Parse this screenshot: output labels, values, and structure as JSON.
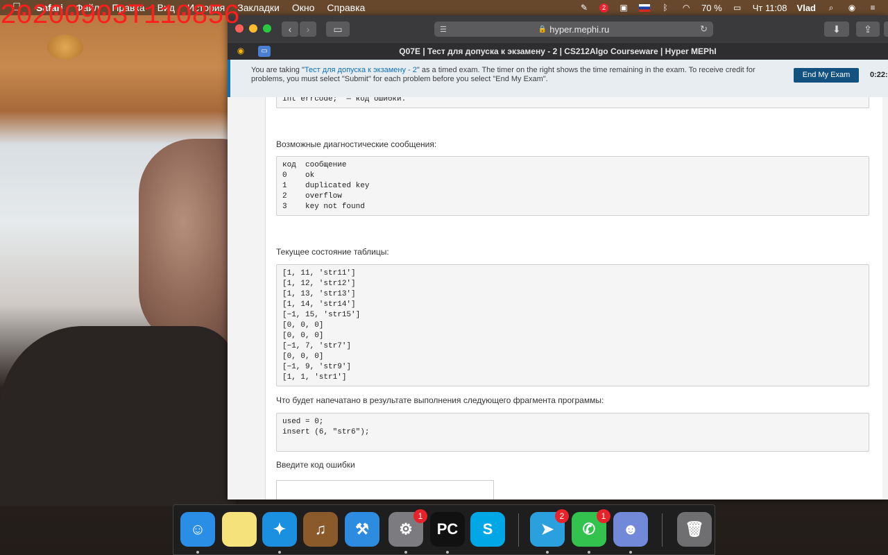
{
  "camera_stamp": "20200903T110856",
  "menubar": {
    "app": "Safari",
    "items": [
      "Файл",
      "Правка",
      "Вид",
      "История",
      "Закладки",
      "Окно",
      "Справка"
    ],
    "battery": "70 %",
    "clock": "Чт 11:08",
    "user": "Vlad",
    "notif_count": "2"
  },
  "browser": {
    "url": "hyper.mephi.ru",
    "tab_title": "Q07E | Тест для допуска к экзамену - 2 | CS212Algo Courseware | Hyper MEPhI"
  },
  "notice": {
    "before": "You are taking \"",
    "link": "Тест для допуска к экзамену - 2",
    "after": "\" as a timed exam. The timer on the right shows the time remaining in the exam. To receive credit for problems, you must select \"Submit\" for each problem before you select \"End My Exam\".",
    "end_button": "End My Exam",
    "timer": "0:22:"
  },
  "content": {
    "code_top": "int errcode;  — код ошибки.",
    "diag_heading": "Возможные диагностические сообщения:",
    "diag_table": "код  сообщение\n0    ok\n1    duplicated key\n2    overflow\n3    key not found",
    "table_heading": "Текущее состояние таблицы:",
    "table_state": "[1, 11, 'str11']\n[1, 12, 'str12']\n[1, 13, 'str13']\n[1, 14, 'str14']\n[−1, 15, 'str15']\n[0, 0, 0]\n[0, 0, 0]\n[−1, 7, 'str7']\n[0, 0, 0]\n[−1, 9, 'str9']\n[1, 1, 'str1']",
    "question": "Что будет напечатано в результате выполнения следующего фрагмента программы:",
    "program": "used = 0;\ninsert (6, \"str6\");",
    "input_label": "Введите код ошибки"
  },
  "dock": {
    "items": [
      {
        "name": "finder-icon",
        "glyph": "☺",
        "color": "#2a8de6"
      },
      {
        "name": "notes-icon",
        "glyph": "",
        "color": "#f5e27a"
      },
      {
        "name": "safari-icon",
        "glyph": "✦",
        "color": "#1b8fe0"
      },
      {
        "name": "garageband-icon",
        "glyph": "♫",
        "color": "#8a5a2b"
      },
      {
        "name": "xcode-icon",
        "glyph": "⚒",
        "color": "#2d8be0"
      },
      {
        "name": "system-preferences-icon",
        "glyph": "⚙",
        "color": "#7c7c80",
        "badge": "1"
      },
      {
        "name": "pycharm-icon",
        "glyph": "PC",
        "color": "#111111"
      },
      {
        "name": "skype-icon",
        "glyph": "S",
        "color": "#00a7e6"
      },
      {
        "name": "telegram-icon",
        "glyph": "➤",
        "color": "#2aa1de",
        "badge": "2"
      },
      {
        "name": "facetime-icon",
        "glyph": "✆",
        "color": "#32c24d",
        "badge": "1"
      },
      {
        "name": "discord-icon",
        "glyph": "☻",
        "color": "#7289da"
      },
      {
        "name": "trash-icon",
        "glyph": "🗑",
        "color": "#6f6f72"
      }
    ]
  }
}
